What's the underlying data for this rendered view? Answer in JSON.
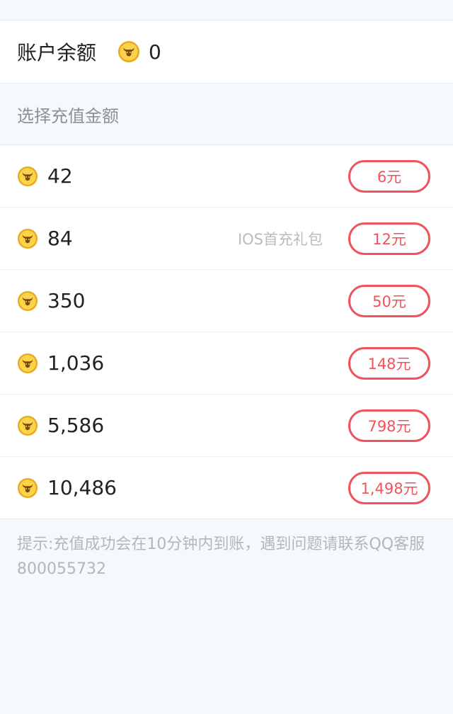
{
  "balance": {
    "label": "账户余额",
    "value": "0",
    "icon": "bull-coin-icon"
  },
  "section": {
    "title": "选择充值金额"
  },
  "packages": [
    {
      "coins": "42",
      "price": "6元",
      "tag": ""
    },
    {
      "coins": "84",
      "price": "12元",
      "tag": "IOS首充礼包"
    },
    {
      "coins": "350",
      "price": "50元",
      "tag": ""
    },
    {
      "coins": "1,036",
      "price": "148元",
      "tag": ""
    },
    {
      "coins": "5,586",
      "price": "798元",
      "tag": ""
    },
    {
      "coins": "10,486",
      "price": "1,498元",
      "tag": ""
    }
  ],
  "tip": {
    "text": "提示:充值成功会在10分钟内到账，遇到问题请联系QQ客服800055732"
  },
  "colors": {
    "accent": "#f0535b",
    "coin_gold": "#f6c23c",
    "background": "#f5f9fd"
  }
}
